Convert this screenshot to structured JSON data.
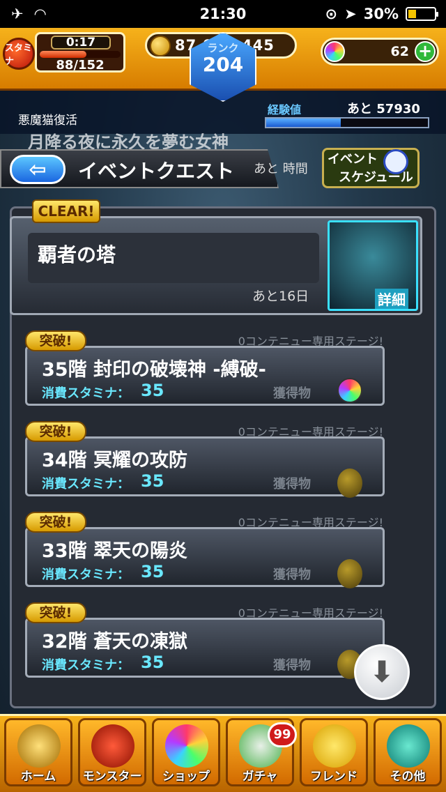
{
  "status_bar": {
    "time": "21:30",
    "battery": "30%",
    "battery_fraction": 0.3
  },
  "hud": {
    "stamina_icon_label": "スタミナ",
    "stamina_timer": "0:17",
    "stamina_count": "88/152",
    "stamina_fraction": 0.58,
    "gold": "87,955,445",
    "orbs": "62",
    "plus": "+",
    "rank_label": "ランク",
    "rank": "204",
    "exp_label": "経験値",
    "exp_next": "あと 57930",
    "exp_fraction": 0.46,
    "current_quest": "悪魔猫復活"
  },
  "banner_text": "月降る夜に永久を夢む女神",
  "header": {
    "back_icon": "back-arrow-icon",
    "title": "イベントクエスト",
    "remaining": "あと 時間",
    "schedule_line1": "イベント",
    "schedule_line2": "スケジュール"
  },
  "tower": {
    "clear_badge": "CLEAR!",
    "name": "覇者の塔",
    "remaining": "あと16日",
    "detail": "詳細"
  },
  "stages": [
    {
      "badge": "突破!",
      "tag": "0コンテニュー専用ステージ!",
      "title": "35階 封印の破壊神 -縛破-",
      "cost_label": "消費スタミナ：",
      "cost": "35",
      "reward_label": "獲得物",
      "reward": "orb"
    },
    {
      "badge": "突破!",
      "tag": "0コンテニュー専用ステージ!",
      "title": "34階 冥耀の攻防",
      "cost_label": "消費スタミナ：",
      "cost": "35",
      "reward_label": "獲得物",
      "reward": "egg"
    },
    {
      "badge": "突破!",
      "tag": "0コンテニュー専用ステージ!",
      "title": "33階 翠天の陽炎",
      "cost_label": "消費スタミナ：",
      "cost": "35",
      "reward_label": "獲得物",
      "reward": "egg"
    },
    {
      "badge": "突破!",
      "tag": "0コンテニュー専用ステージ!",
      "title": "32階 蒼天の凍獄",
      "cost_label": "消費スタミナ：",
      "cost": "35",
      "reward_label": "獲得物",
      "reward": "egg"
    }
  ],
  "scroll_icon": "download-arrow-icon",
  "nav": {
    "items": [
      {
        "label": "ホーム",
        "icon": "home-icon"
      },
      {
        "label": "モンスター",
        "icon": "monster-icon"
      },
      {
        "label": "ショップ",
        "icon": "shop-icon"
      },
      {
        "label": "ガチャ",
        "icon": "gacha-icon"
      },
      {
        "label": "フレンド",
        "icon": "friend-icon"
      },
      {
        "label": "その他",
        "icon": "other-icon"
      }
    ],
    "gacha_badge": "99"
  }
}
